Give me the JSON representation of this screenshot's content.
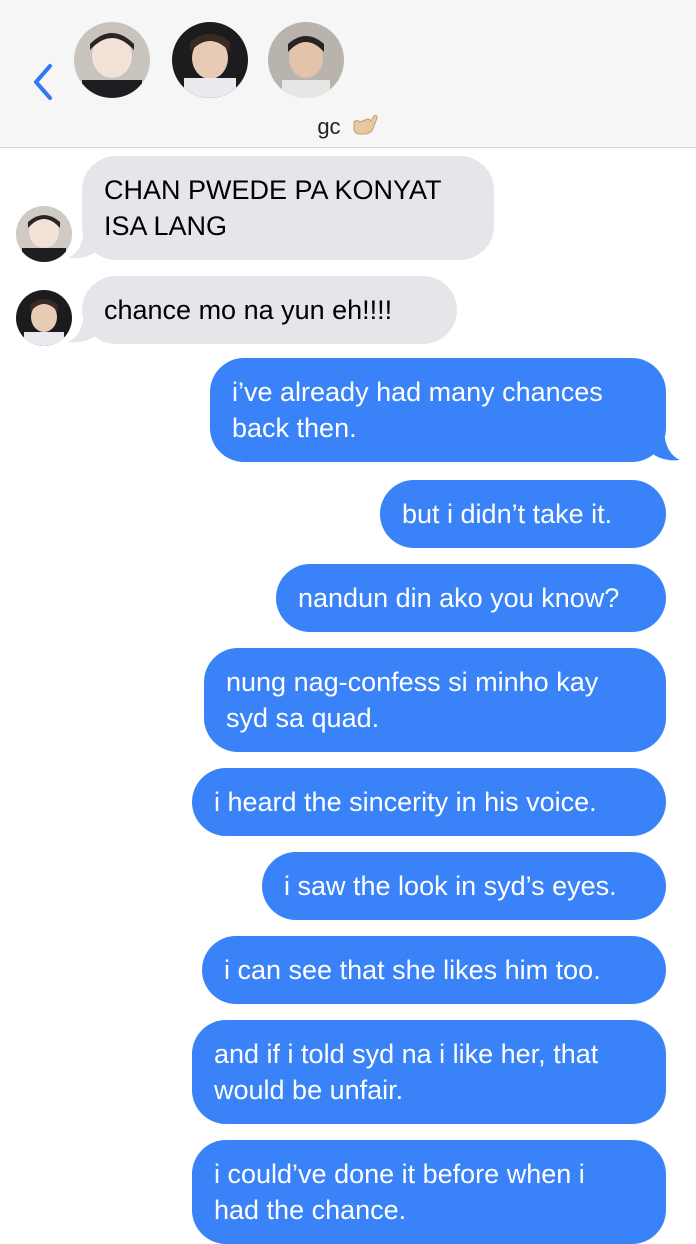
{
  "header": {
    "group_name": "gc",
    "emoji": "call-me-hand"
  },
  "colors": {
    "outgoing": "#3a82f7",
    "incoming": "#e5e5ea",
    "accent": "#3478f6"
  },
  "messages": [
    {
      "dir": "in",
      "sender": 1,
      "lines": [
        "CHAN PWEDE PA KONYAT",
        "ISA LANG"
      ]
    },
    {
      "dir": "in",
      "sender": 2,
      "lines": [
        "chance mo na yun eh!!!!"
      ]
    },
    {
      "dir": "out",
      "lines": [
        "i’ve already had many chances",
        "back then."
      ]
    },
    {
      "dir": "out",
      "lines": [
        "but i didn’t take it."
      ]
    },
    {
      "dir": "out",
      "lines": [
        "nandun din ako you know?"
      ]
    },
    {
      "dir": "out",
      "lines": [
        "nung nag-confess si minho kay",
        "syd sa quad."
      ]
    },
    {
      "dir": "out",
      "lines": [
        "i heard the sincerity in his voice."
      ]
    },
    {
      "dir": "out",
      "lines": [
        "i saw the look in syd’s eyes."
      ]
    },
    {
      "dir": "out",
      "lines": [
        "i can see that she likes him too."
      ]
    },
    {
      "dir": "out",
      "lines": [
        "and if i told syd na i like her, that",
        "would be unfair."
      ]
    },
    {
      "dir": "out",
      "lines": [
        "i could’ve done it before when i",
        "had the chance."
      ]
    }
  ]
}
